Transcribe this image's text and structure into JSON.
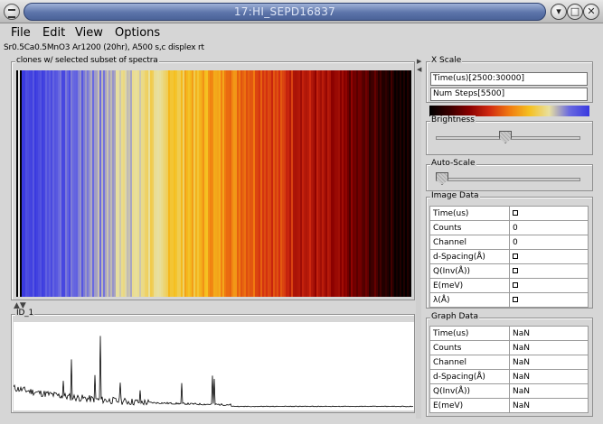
{
  "window": {
    "title": "17:HI_SEPD16837",
    "minimize": "▾",
    "maximize": "□",
    "close": "✕"
  },
  "menu": [
    "File",
    "Edit",
    "View",
    "Options"
  ],
  "dataset_title": "Sr0.5Ca0.5MnO3 Ar1200 (20hr), A500 s,c displex rt",
  "image_panel": {
    "label": "clones w/ selected subset of spectra"
  },
  "graph_panel": {
    "label": "ID_1"
  },
  "x_scale": {
    "label": "X Scale",
    "time_field": "Time(us)[2500:30000]",
    "steps_field": "Num Steps[5500]"
  },
  "brightness": {
    "label": "Brightness",
    "level": 0.48
  },
  "auto_scale": {
    "label": "Auto-Scale",
    "level": 0.0
  },
  "image_data": {
    "label": "Image Data",
    "rows": [
      {
        "key": "Time(us)",
        "value": "",
        "checkbox": true
      },
      {
        "key": "Counts",
        "value": "0"
      },
      {
        "key": "Channel",
        "value": "0"
      },
      {
        "key": "d-Spacing(Å)",
        "value": "",
        "checkbox": true
      },
      {
        "key": "Q(Inv(Å))",
        "value": "",
        "checkbox": true
      },
      {
        "key": "E(meV)",
        "value": "",
        "checkbox": true
      },
      {
        "key": "λ(Å)",
        "value": "",
        "checkbox": true
      }
    ]
  },
  "graph_data": {
    "label": "Graph Data",
    "rows": [
      {
        "key": "Time(us)",
        "value": "NaN"
      },
      {
        "key": "Counts",
        "value": "NaN"
      },
      {
        "key": "Channel",
        "value": "NaN"
      },
      {
        "key": "d-Spacing(Å)",
        "value": "NaN"
      },
      {
        "key": "Q(Inv(Å))",
        "value": "NaN"
      },
      {
        "key": "E(meV)",
        "value": "NaN"
      }
    ]
  },
  "colors": {
    "title_bar": "#5c74aa",
    "background": "#d6d6d6",
    "colorscale": [
      "#000000",
      "#3a0000",
      "#8a0000",
      "#d02a10",
      "#f07a10",
      "#f5c020",
      "#e8e0a0",
      "#6a6ae0",
      "#3a3ae0"
    ]
  }
}
